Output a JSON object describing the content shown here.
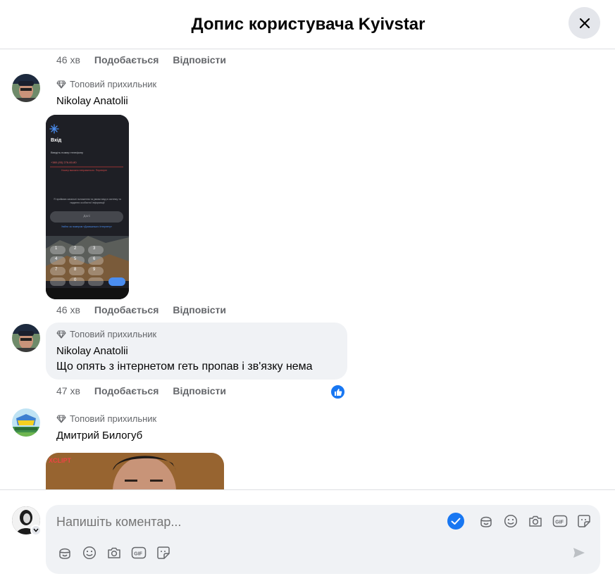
{
  "header": {
    "title": "Допис користувача Kyivstar"
  },
  "comments": [
    {
      "time": "46 хв",
      "like_label": "Подобається",
      "reply_label": "Відповісти"
    },
    {
      "badge": "Топовий прихильник",
      "author": "Nikolay Anatolii",
      "image": {
        "title": "Вхід",
        "prompt": "Введіть номер телефону",
        "phone_value": "+380 (93) 276-60-80",
        "error": "Номер вказано неправильно. Перевірте",
        "note": "Я приймаю загальні положення та умови вхід в систему та надання особистої інформації",
        "button": "Далі",
        "link": "Увійти за номером «Домашнього Інтернету»"
      },
      "time": "46 хв",
      "like_label": "Подобається",
      "reply_label": "Відповісти"
    },
    {
      "badge": "Топовий прихильник",
      "author": "Nikolay Anatolii",
      "text": "Що опять з інтернетом геть пропав і зв'язку нема",
      "time": "47 хв",
      "like_label": "Подобається",
      "reply_label": "Відповісти",
      "reaction": "like"
    },
    {
      "badge": "Топовий прихильник",
      "author": "Дмитрий Билогуб"
    }
  ],
  "composer": {
    "placeholder": "Напишіть коментар...",
    "icons": [
      "check-circle-icon",
      "avatar-sticker-icon",
      "emoji-icon",
      "camera-icon",
      "gif-icon",
      "sticker-icon",
      "send-icon"
    ]
  },
  "colors": {
    "accent": "#1877f2",
    "bubble": "#f0f2f5",
    "secondary_text": "#65676b"
  }
}
